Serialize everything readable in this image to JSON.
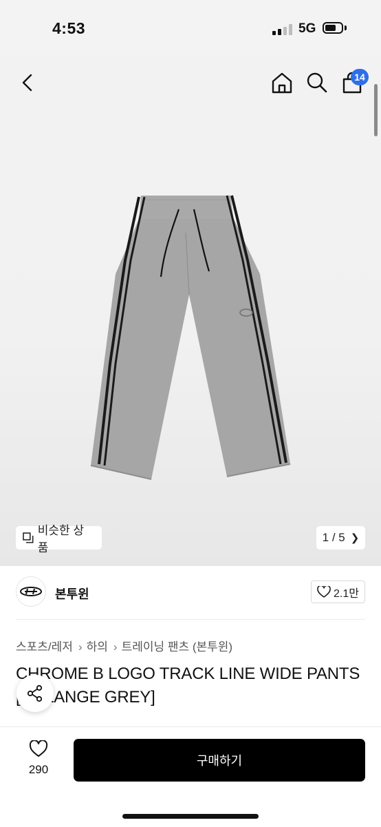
{
  "status_bar": {
    "time": "4:53",
    "network": "5G"
  },
  "header": {
    "back_icon": "chevron-left-icon",
    "home_icon": "home-icon",
    "search_icon": "search-icon",
    "cart_icon": "shopping-bag-icon",
    "cart_count": "14",
    "badge_color": "#2f6fe6"
  },
  "gallery": {
    "similar_label": "비슷한 상품",
    "page_current": "1",
    "page_total": "5",
    "page_text": "1 / 5"
  },
  "brand": {
    "name": "본투윈",
    "like_count": "2.1만"
  },
  "breadcrumb": [
    "스포츠/레저",
    "하의",
    "트레이닝 팬츠 (본투윈)"
  ],
  "product": {
    "title": "CHROME B LOGO TRACK LINE WIDE PANTS [MELANGE GREY]"
  },
  "bottom_bar": {
    "wish_count": "290",
    "buy_label": "구매하기",
    "buy_color": "#000000"
  }
}
